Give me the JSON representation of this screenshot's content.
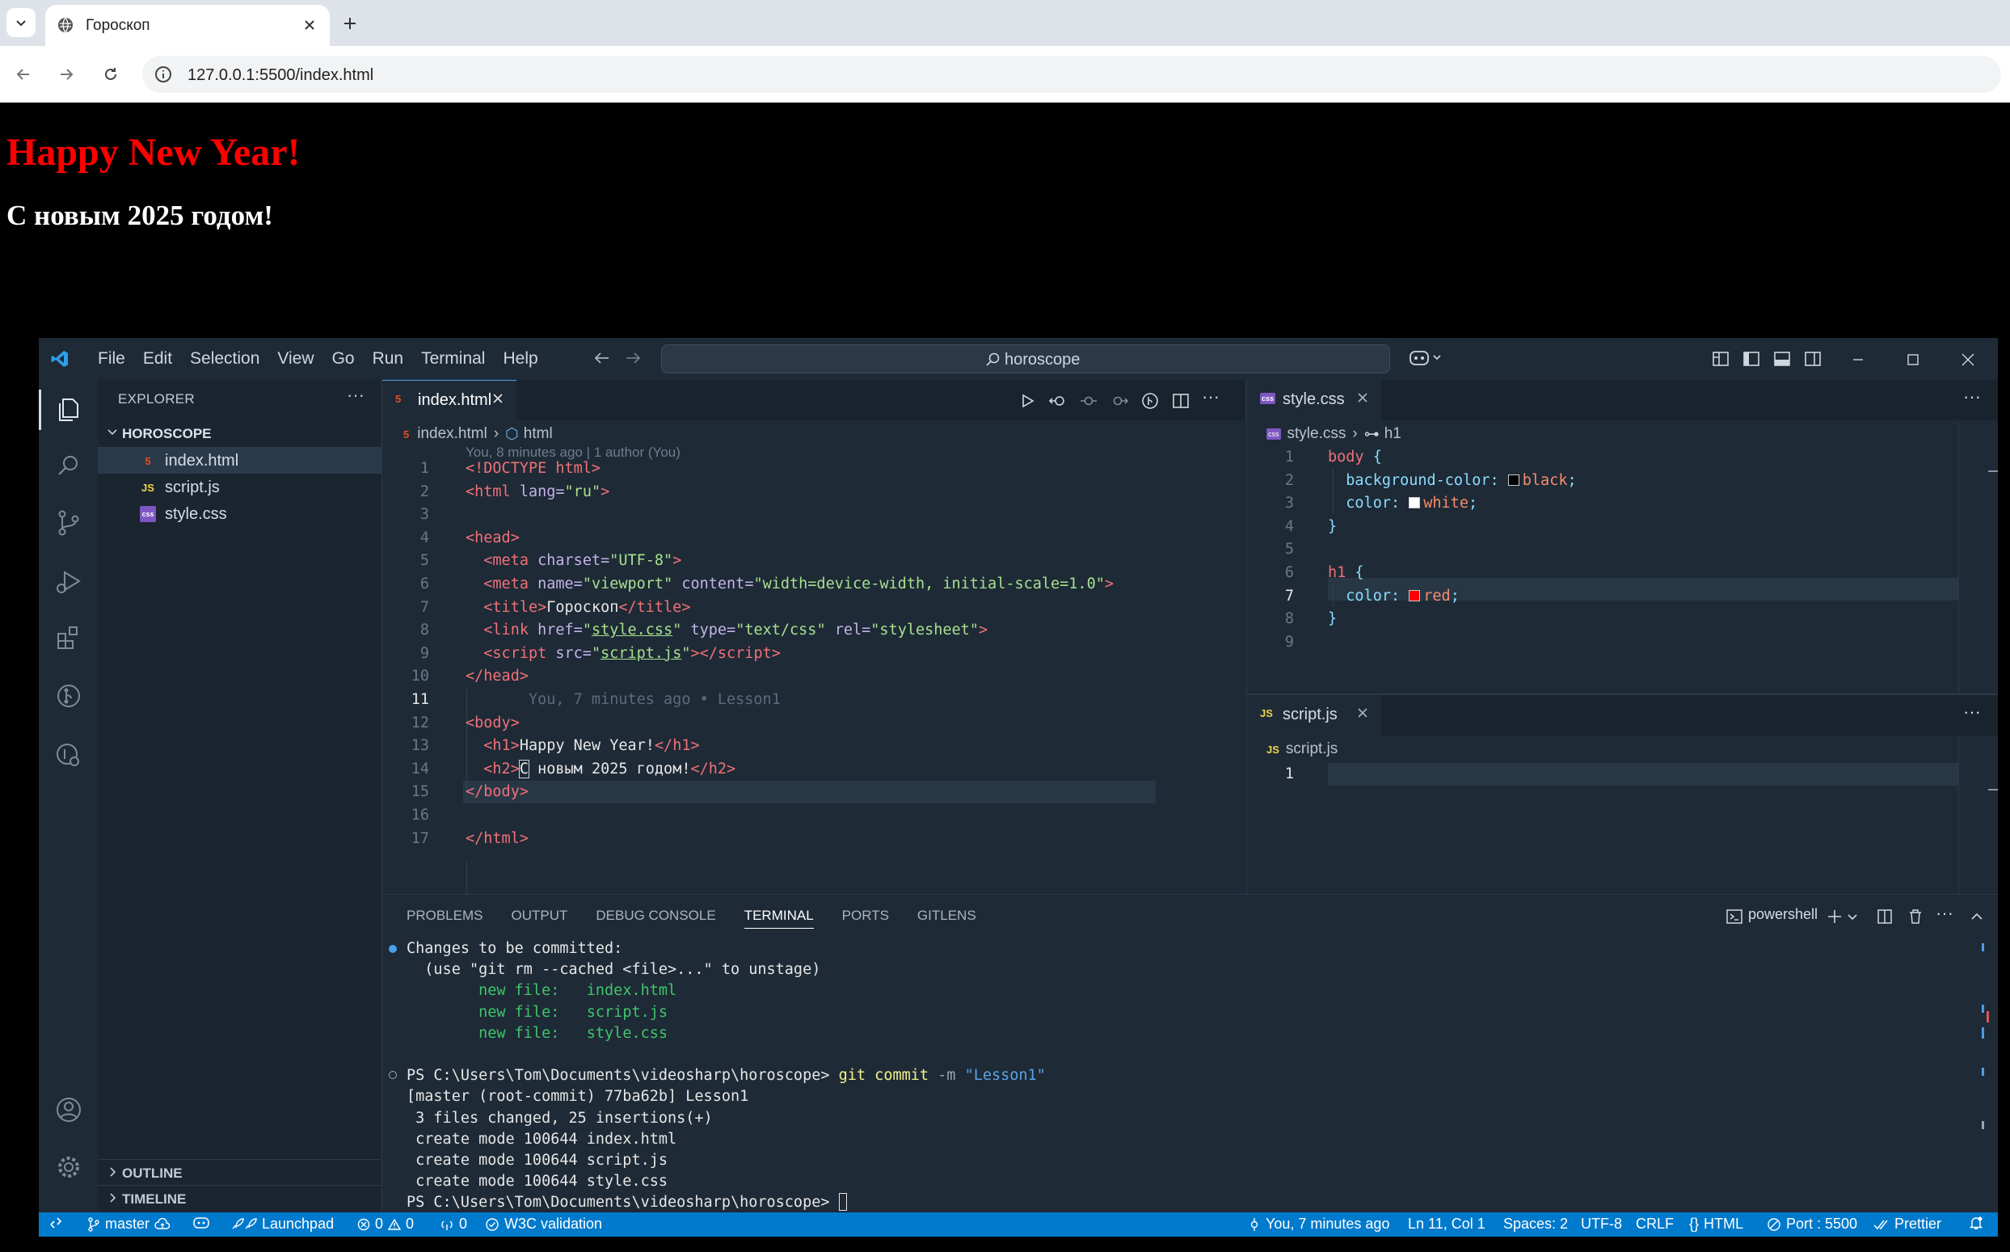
{
  "browser": {
    "tab_title": "Гороскоп",
    "url": "127.0.0.1:5500/index.html"
  },
  "page": {
    "h1": "Happy New Year!",
    "h2": "С новым 2025 годом!"
  },
  "vscode": {
    "menu": [
      "File",
      "Edit",
      "Selection",
      "View",
      "Go",
      "Run",
      "Terminal",
      "Help"
    ],
    "command_center": "horoscope",
    "sidebar": {
      "title": "EXPLORER",
      "folder": "HOROSCOPE",
      "files": [
        {
          "name": "index.html",
          "icon": "5",
          "color": "#e44d26"
        },
        {
          "name": "script.js",
          "icon": "JS",
          "color": "#f0d44a"
        },
        {
          "name": "style.css",
          "icon": "css",
          "color": "#7e57c2"
        }
      ],
      "outline": "OUTLINE",
      "timeline": "TIMELINE"
    },
    "editor1": {
      "tab": "index.html",
      "breadcrumb_file": "index.html",
      "breadcrumb_symbol": "html",
      "blame_header": "You, 8 minutes ago | 1 author (You)",
      "inline_blame": "You, 7 minutes ago • Lesson1",
      "line_numbers": [
        "1",
        "2",
        "3",
        "4",
        "5",
        "6",
        "7",
        "8",
        "9",
        "10",
        "11",
        "12",
        "13",
        "14",
        "15",
        "16",
        "17"
      ],
      "current_line": "11"
    },
    "editor2": {
      "tab": "style.css",
      "breadcrumb_file": "style.css",
      "breadcrumb_symbol": "h1",
      "line_numbers": [
        "1",
        "2",
        "3",
        "4",
        "5",
        "6",
        "7",
        "8",
        "9"
      ],
      "current_line": "7"
    },
    "editor3": {
      "tab": "script.js",
      "breadcrumb_file": "script.js",
      "line_numbers": [
        "1"
      ]
    },
    "panel": {
      "tabs": [
        "PROBLEMS",
        "OUTPUT",
        "DEBUG CONSOLE",
        "TERMINAL",
        "PORTS",
        "GITLENS"
      ],
      "active_tab": "TERMINAL",
      "terminal_name": "powershell",
      "lines": {
        "l1": "Changes to be committed:",
        "l2": "  (use \"git rm --cached <file>...\" to unstage)",
        "l3_label": "        new file:   ",
        "l3_file": "index.html",
        "l4_file": "script.js",
        "l5_file": "style.css",
        "l7_prompt": "PS C:\\Users\\Tom\\Documents\\videosharp\\horoscope> ",
        "l7_cmd": "git commit",
        "l7_flag": " -m ",
        "l7_msg": "\"Lesson1\"",
        "l8": "[master (root-commit) 77ba62b] Lesson1",
        "l9": " 3 files changed, 25 insertions(+)",
        "l10": " create mode 100644 index.html",
        "l11": " create mode 100644 script.js",
        "l12": " create mode 100644 style.css",
        "l13": "PS C:\\Users\\Tom\\Documents\\videosharp\\horoscope> "
      }
    },
    "status": {
      "branch": "master",
      "launchpad": "Launchpad",
      "errors": "0",
      "warnings": "0",
      "ports": "0",
      "w3c": "W3C validation",
      "blame": "You, 7 minutes ago",
      "position": "Ln 11, Col 1",
      "spaces": "Spaces: 2",
      "encoding": "UTF-8",
      "eol": "CRLF",
      "language": "HTML",
      "port": "Port : 5500",
      "prettier": "Prettier"
    }
  }
}
